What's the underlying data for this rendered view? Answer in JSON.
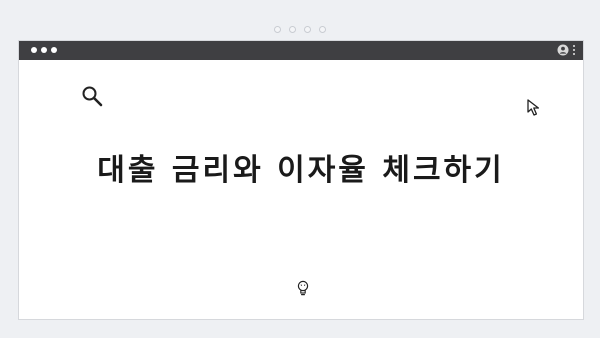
{
  "window": {
    "headline": "대출 금리와 이자율 체크하기"
  },
  "icons": {
    "search": "search-icon",
    "cursor": "cursor-arrow-icon",
    "lightbulb": "lightbulb-icon",
    "user": "user-icon",
    "menu": "kebab-menu-icon"
  },
  "colors": {
    "titlebar": "#3f3f42",
    "background": "#eef0f3",
    "window": "#ffffff",
    "text": "#1a1a1a"
  }
}
